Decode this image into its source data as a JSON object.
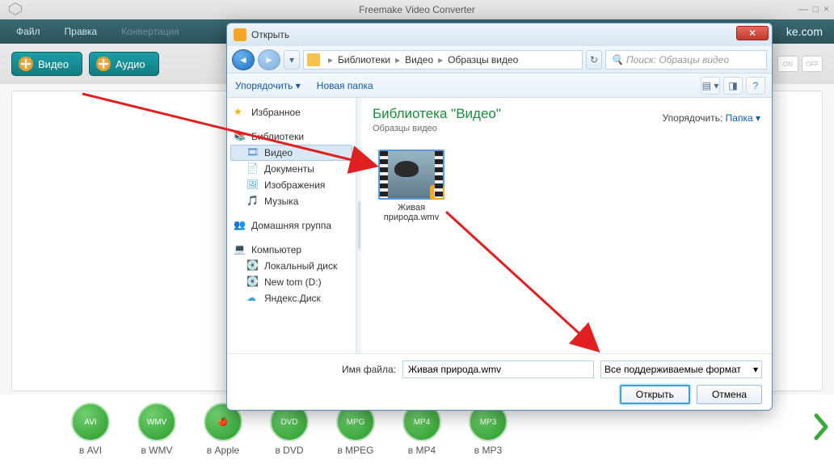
{
  "app": {
    "title": "Freemake Video Converter",
    "brand": "ke.com",
    "menu": {
      "file": "Файл",
      "edit": "Правка",
      "convert": "Конвертация"
    },
    "toolbar": {
      "video": "Видео",
      "audio": "Аудио",
      "on": "ON",
      "off": "OFF"
    },
    "formats": [
      "в AVI",
      "в WMV",
      "в Apple",
      "в DVD",
      "в MPEG",
      "в MP4",
      "в MP3"
    ]
  },
  "dialog": {
    "title": "Открыть",
    "crumbs": {
      "c1": "Библиотеки",
      "c2": "Видео",
      "c3": "Образцы видео"
    },
    "search_placeholder": "Поиск: Образцы видео",
    "tools": {
      "organize": "Упорядочить",
      "newfolder": "Новая папка"
    },
    "tree": {
      "fav": "Избранное",
      "libs": "Библиотеки",
      "video": "Видео",
      "docs": "Документы",
      "images": "Изображения",
      "music": "Музыка",
      "home": "Домашняя группа",
      "computer": "Компьютер",
      "local": "Локальный диск",
      "newtom": "New tom (D:)",
      "yadisk": "Яндекс.Диск"
    },
    "content": {
      "libhead": "Библиотека \"Видео\"",
      "libsub": "Образцы видео",
      "sort_label": "Упорядочить:",
      "sort_value": "Папка",
      "file": "Живая природа.wmv"
    },
    "foot": {
      "filelabel": "Имя файла:",
      "filename": "Живая природа.wmv",
      "filter": "Все поддерживаемые формат",
      "open": "Открыть",
      "cancel": "Отмена"
    }
  }
}
